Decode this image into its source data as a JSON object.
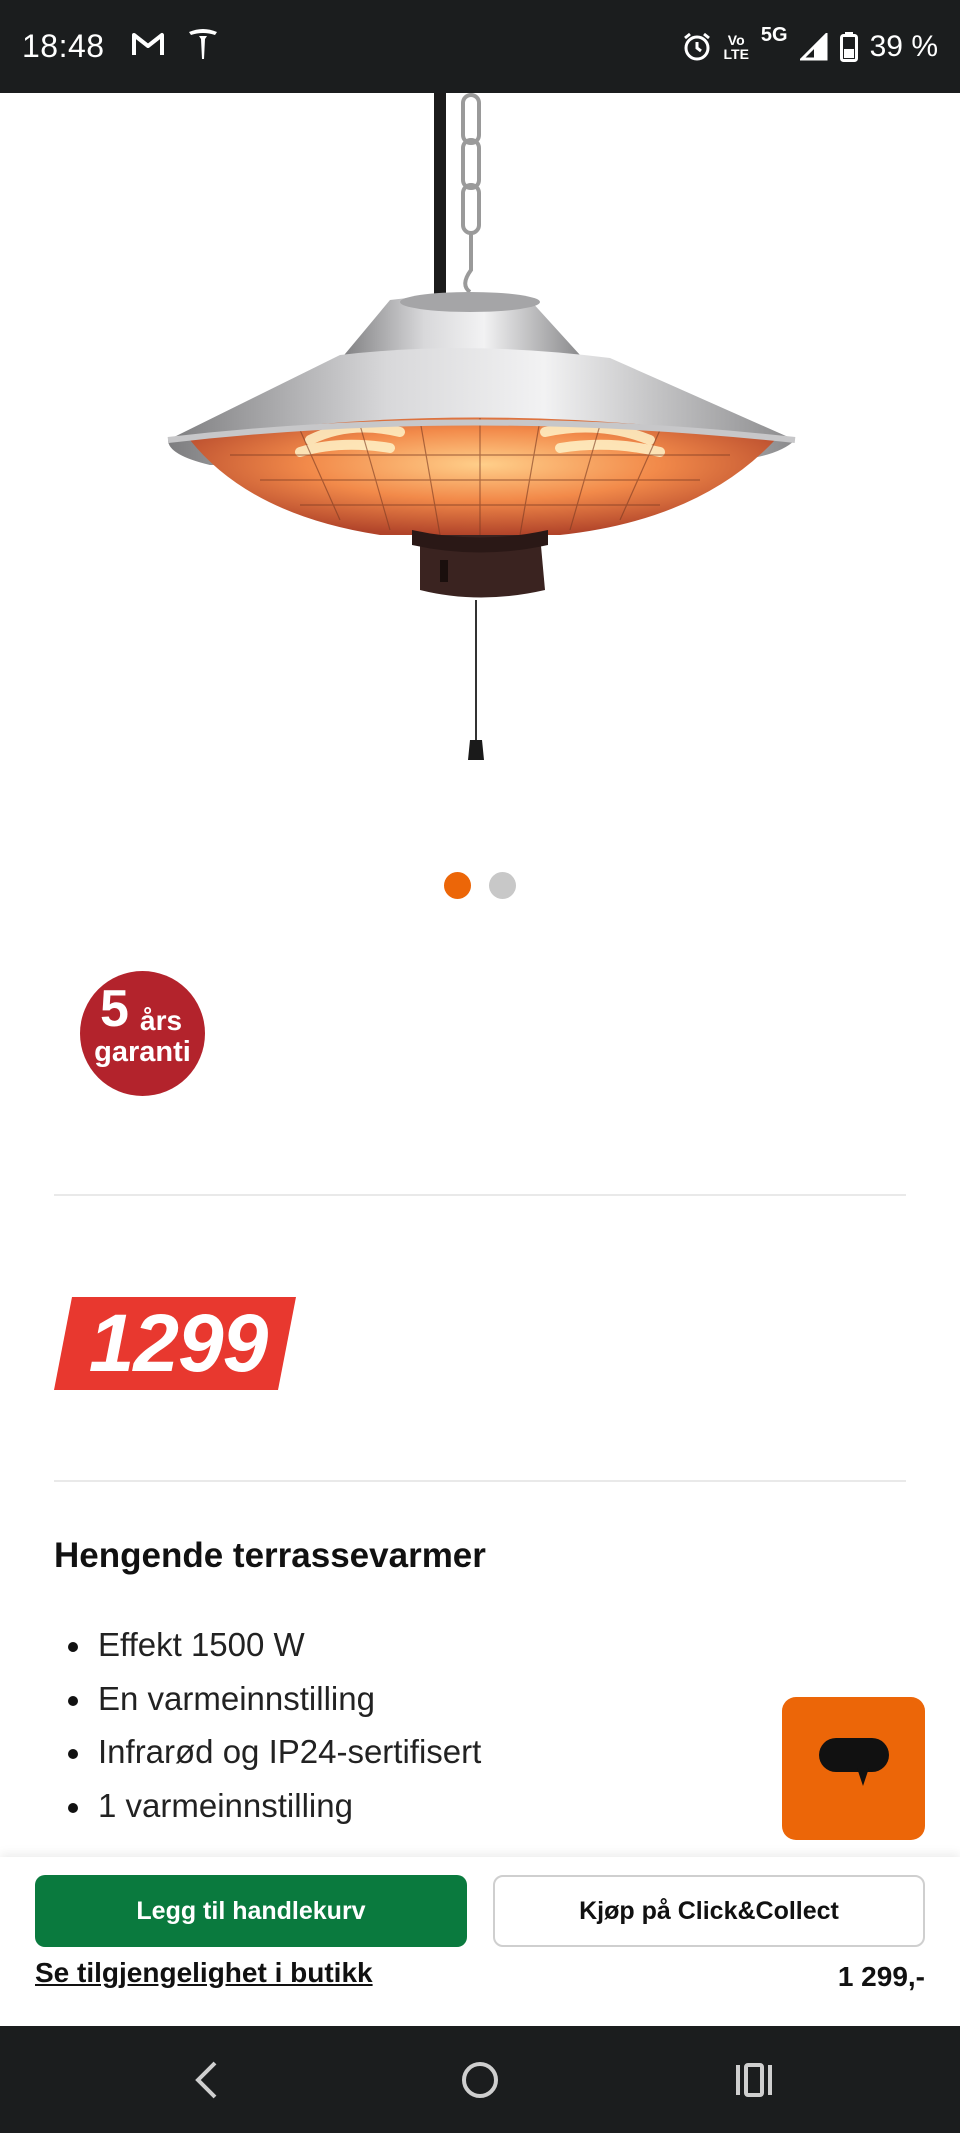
{
  "status_bar": {
    "time": "18:48",
    "left_icons": [
      "gmail-icon",
      "tesla-icon"
    ],
    "right_icons": [
      "alarm-icon",
      "volte-icon",
      "network-5g-icon",
      "signal-icon",
      "battery-icon"
    ],
    "network_label": "5G",
    "volte_top": "Vo",
    "volte_bottom": "LTE",
    "battery": "39 %"
  },
  "gallery": {
    "image": "hanging-patio-heater-image",
    "dots_total": 2,
    "active_dot": 1,
    "active_color": "#ec6608"
  },
  "warranty": {
    "number": "5",
    "years": "års",
    "label": "garanti",
    "color": "#b3232c"
  },
  "price": {
    "badge_value": "1299",
    "badge_color": "#e8382f"
  },
  "product": {
    "title": "Hengende terrassevarmer",
    "features": [
      "Effekt 1500 W",
      "En varmeinnstilling",
      "Infrarød og IP24-sertifisert",
      "1 varmeinnstilling"
    ]
  },
  "chat": {
    "icon": "chat-bubble-icon",
    "color": "#ec6608"
  },
  "action_bar": {
    "add_to_cart": "Legg til handlekurv",
    "click_collect": "Kjøp på Click&Collect",
    "store_availability": "Se tilgjengelighet i butikk",
    "price": "1 299,-",
    "primary_color": "#0a7a3e"
  },
  "nav_bar": {
    "buttons": [
      "back-icon",
      "home-icon",
      "recents-icon"
    ]
  }
}
